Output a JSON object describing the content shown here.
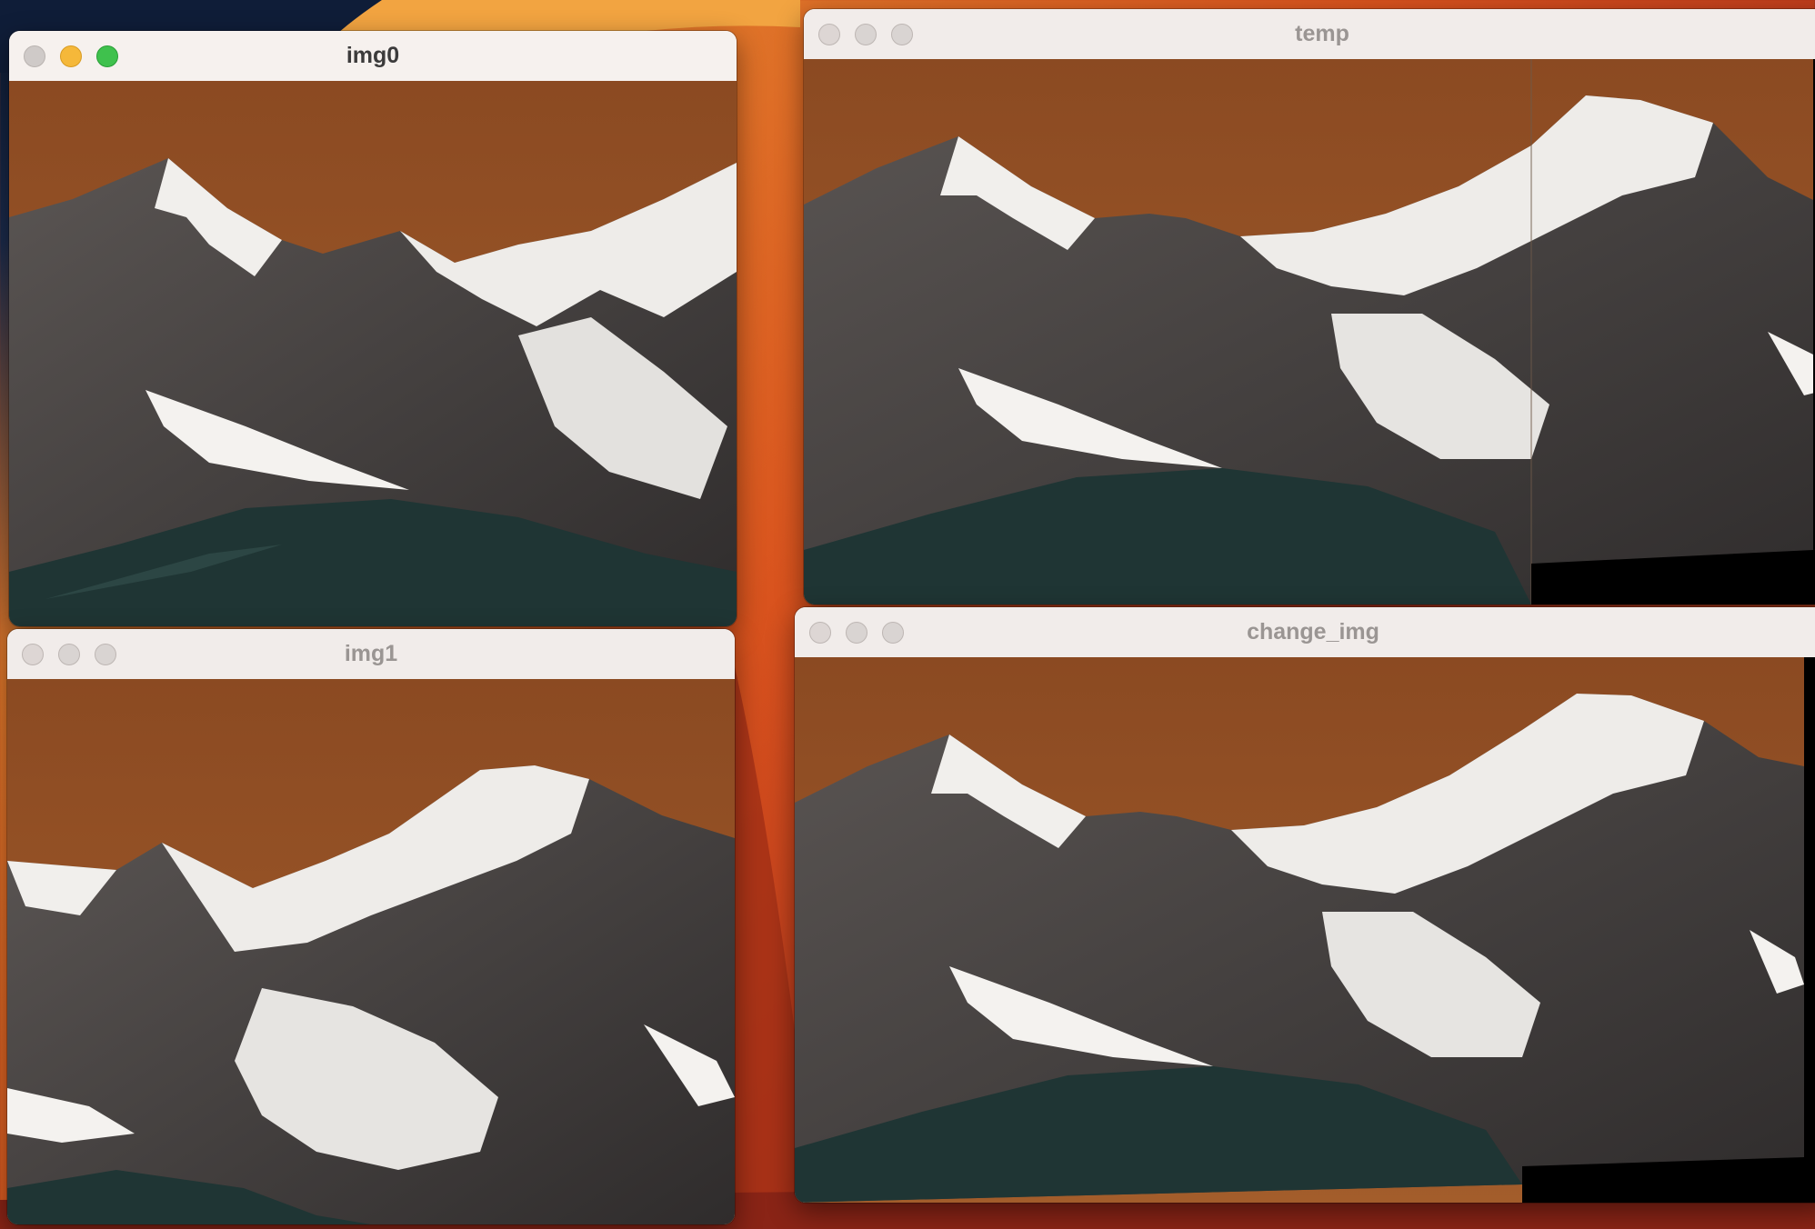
{
  "desktop": {
    "wallpaper": "macOS Ventura orange wallpaper"
  },
  "windows": [
    {
      "id": "img0",
      "title": "img0",
      "active": true
    },
    {
      "id": "img1",
      "title": "img1",
      "active": false
    },
    {
      "id": "temp",
      "title": "temp",
      "active": false
    },
    {
      "id": "change_img",
      "title": "change_img",
      "active": false
    }
  ],
  "colors": {
    "sky": "#8b4a22",
    "sky_light": "#a05a2b",
    "rock_dark": "#3e3b3b",
    "rock_mid": "#6d6866",
    "snow": "#f1efec",
    "meadow": "#1f3534",
    "black_fill": "#000000"
  },
  "icons": {
    "close": "close-button-icon",
    "minimize": "minimize-button-icon",
    "zoom": "zoom-button-icon"
  }
}
